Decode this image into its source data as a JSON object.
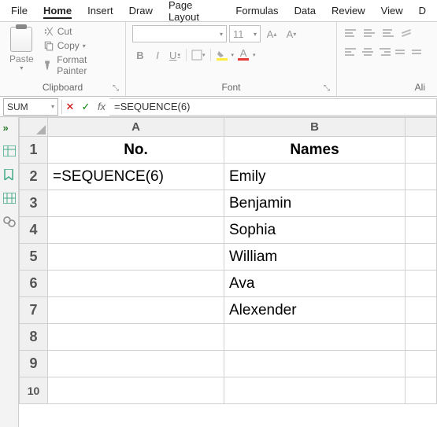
{
  "menu": {
    "tabs": [
      "File",
      "Home",
      "Insert",
      "Draw",
      "Page Layout",
      "Formulas",
      "Data",
      "Review",
      "View",
      "D"
    ],
    "active": "Home"
  },
  "ribbon": {
    "clipboard": {
      "paste": "Paste",
      "cut": "Cut",
      "copy": "Copy",
      "format_painter": "Format Painter",
      "label": "Clipboard"
    },
    "font": {
      "size": "11",
      "label": "Font"
    },
    "alignment": {
      "label": "Ali"
    }
  },
  "formula_bar": {
    "name_box": "SUM",
    "formula": "=SEQUENCE(6)"
  },
  "sheet": {
    "columns": [
      "A",
      "B"
    ],
    "rows": [
      {
        "num": "1",
        "A": "No.",
        "B": "Names",
        "header": true
      },
      {
        "num": "2",
        "A": "=SEQUENCE(6)",
        "B": "Emily",
        "editing": true
      },
      {
        "num": "3",
        "A": "",
        "B": "Benjamin"
      },
      {
        "num": "4",
        "A": "",
        "B": "Sophia"
      },
      {
        "num": "5",
        "A": "",
        "B": "William"
      },
      {
        "num": "6",
        "A": "",
        "B": "Ava"
      },
      {
        "num": "7",
        "A": "",
        "B": "Alexender"
      },
      {
        "num": "8",
        "A": "",
        "B": ""
      },
      {
        "num": "9",
        "A": "",
        "B": ""
      },
      {
        "num": "10",
        "A": "",
        "B": ""
      }
    ]
  }
}
